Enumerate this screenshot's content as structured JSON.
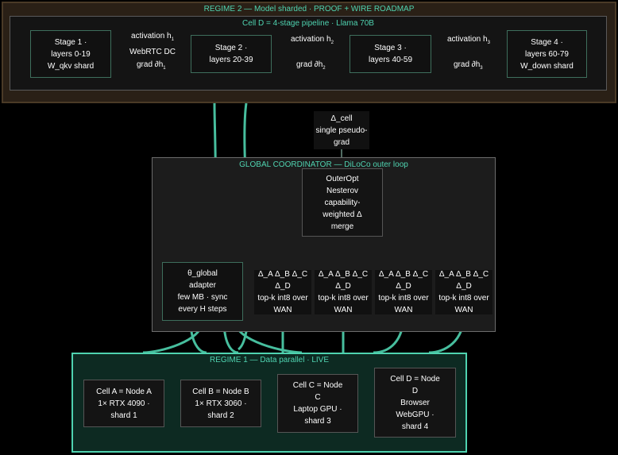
{
  "colors": {
    "accent": "#4fd3b0",
    "regime2_fill": "#2a2016",
    "regime1_fill": "#0d2a22",
    "box_fill": "#111111"
  },
  "regime2": {
    "title": "REGIME 2 — Model sharded · PROOF + WIRE ROADMAP",
    "cell_title": "Cell D = 4-stage pipeline · Llama 70B",
    "stages": [
      {
        "line1": "Stage 1 ·",
        "line2": "layers 0-19",
        "line3": "W_qkv shard"
      },
      {
        "line1": "Stage 2 ·",
        "line2": "layers 20-39",
        "line3": ""
      },
      {
        "line1": "Stage 3 ·",
        "line2": "layers 40-59",
        "line3": ""
      },
      {
        "line1": "Stage 4 ·",
        "line2": "layers 60-79",
        "line3": "W_down shard"
      }
    ],
    "edge_labels": {
      "act1": "activation h",
      "act1_sub": "1",
      "act1_line2": "WebRTC DC",
      "act2": "activation h",
      "act2_sub": "2",
      "act3": "activation h",
      "act3_sub": "3",
      "grad1": "grad ∂h",
      "grad1_sub": "1",
      "grad2": "grad ∂h",
      "grad2_sub": "2",
      "grad3": "grad ∂h",
      "grad3_sub": "3"
    }
  },
  "delta_cell": {
    "line1": "Δ_cell",
    "line2": "single pseudo-",
    "line3": "grad"
  },
  "global": {
    "title": "GLOBAL COORDINATOR — DiLoCo outer loop",
    "outeropt": {
      "line1": "OuterOpt",
      "line2": "Nesterov",
      "line3": "capability-",
      "line4": "weighted Δ",
      "line5": "merge"
    },
    "theta": {
      "line1": "θ_global",
      "line2": "adapter",
      "line3": "few MB · sync",
      "line4": "every H steps"
    },
    "wan_boxes": [
      {
        "line1": "Δ_A Δ_B Δ_C",
        "line2": "Δ_D",
        "line3": "top-k int8 over",
        "line4": "WAN"
      },
      {
        "line1": "Δ_A Δ_B Δ_C",
        "line2": "Δ_D",
        "line3": "top-k int8 over",
        "line4": "WAN"
      },
      {
        "line1": "Δ_A Δ_B Δ_C",
        "line2": "Δ_D",
        "line3": "top-k int8 over",
        "line4": "WAN"
      },
      {
        "line1": "Δ_A Δ_B Δ_C",
        "line2": "Δ_D",
        "line3": "top-k int8 over",
        "line4": "WAN"
      }
    ]
  },
  "regime1": {
    "title": "REGIME 1 — Data parallel · LIVE",
    "cells": [
      {
        "line1": "Cell A = Node A",
        "line2": "1× RTX 4090 ·",
        "line3": "shard 1",
        "line4": ""
      },
      {
        "line1": "Cell B = Node B",
        "line2": "1× RTX 3060 ·",
        "line3": "shard 2",
        "line4": ""
      },
      {
        "line1": "Cell C = Node",
        "line2": "C",
        "line3": "Laptop GPU ·",
        "line4": "shard 3"
      },
      {
        "line1": "Cell D = Node",
        "line2": "D",
        "line3": "Browser",
        "line4": "WebGPU ·",
        "line5": "shard 4"
      }
    ]
  }
}
